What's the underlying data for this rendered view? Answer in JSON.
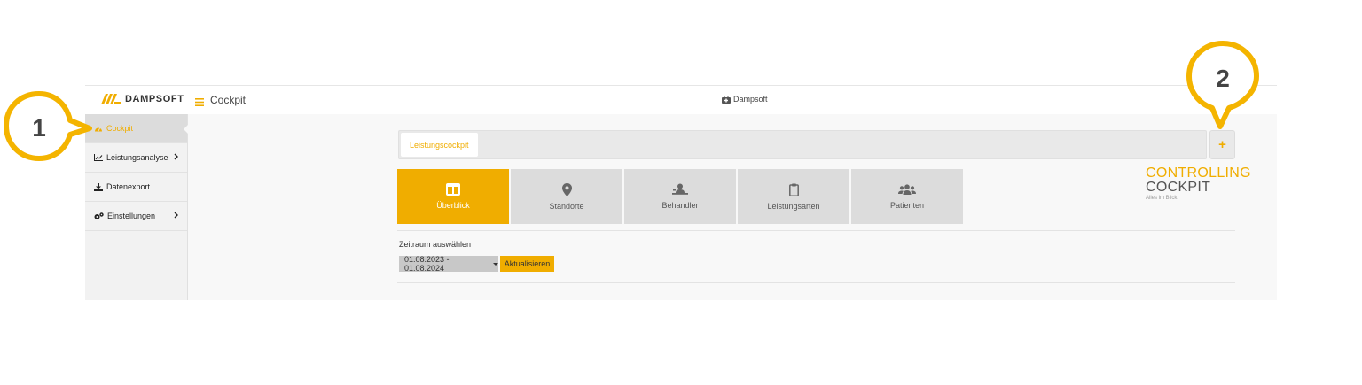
{
  "brand": {
    "logo_text": "DAMPSOFT"
  },
  "header": {
    "title": "Cockpit",
    "center_label": "Dampsoft"
  },
  "sidebar": {
    "items": [
      {
        "label": "Cockpit",
        "icon": "gauge-icon",
        "active": true
      },
      {
        "label": "Leistungsanalyse",
        "icon": "line-chart-icon",
        "has_submenu": true
      },
      {
        "label": "Datenexport",
        "icon": "download-icon"
      },
      {
        "label": "Einstellungen",
        "icon": "gears-icon",
        "has_submenu": true
      }
    ]
  },
  "tabs": {
    "active_label": "Leistungscockpit",
    "add_label": "+"
  },
  "tiles": [
    {
      "label": "Überblick",
      "icon": "columns-icon",
      "active": true
    },
    {
      "label": "Standorte",
      "icon": "map-marker-icon"
    },
    {
      "label": "Behandler",
      "icon": "doctor-icon"
    },
    {
      "label": "Leistungsarten",
      "icon": "clipboard-icon"
    },
    {
      "label": "Patienten",
      "icon": "users-icon"
    }
  ],
  "product": {
    "line1": "CONTROLLING",
    "line2": "COCKPIT",
    "tagline": "Alles im Blick."
  },
  "period": {
    "label": "Zeitraum auswählen",
    "value": "01.08.2023 - 01.08.2024",
    "refresh_label": "Aktualisieren"
  },
  "annotations": [
    {
      "number": "1"
    },
    {
      "number": "2"
    }
  ],
  "colors": {
    "accent": "#f0ad00",
    "tile_inactive": "#dcdcdc",
    "callout_ring": "#f4b400"
  }
}
